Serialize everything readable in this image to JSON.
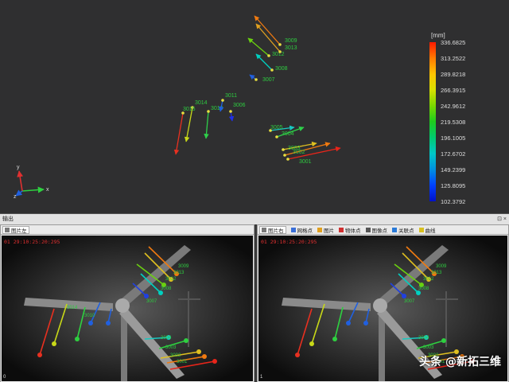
{
  "viewer3d": {
    "axes": {
      "x": "x",
      "y": "y",
      "z": "z"
    },
    "colorbar": {
      "unit": "[mm]",
      "ticks": [
        "336.6825",
        "313.2522",
        "289.8218",
        "266.3915",
        "242.9612",
        "219.5308",
        "196.1005",
        "172.6702",
        "149.2399",
        "125.8095",
        "102.3792"
      ],
      "gradient": [
        "#ff1a00",
        "#ff7a00",
        "#ffc400",
        "#d8e000",
        "#7ad800",
        "#1ecc1e",
        "#00cc70",
        "#00c8c8",
        "#0090e0",
        "#0040ff",
        "#0010c8"
      ]
    },
    "points": [
      "3001",
      "3002",
      "3003",
      "3004",
      "3005",
      "3006",
      "3007",
      "3008",
      "3009",
      "3010",
      "3011",
      "3012",
      "3013",
      "3014",
      "3015"
    ]
  },
  "output_panel": {
    "title": "输出",
    "controls": "⊡ ×",
    "left": {
      "tab": "图片左",
      "timestamp": "01 29:10:25:20:295",
      "cam_index": "0"
    },
    "right": {
      "tab": "图片右",
      "toolbar": [
        "网格点",
        "图片",
        "物体点",
        "图像点",
        "关联点",
        "曲线"
      ],
      "timestamp": "01 29:10:25:20:295",
      "cam_index": "1"
    }
  },
  "watermark": "头条 @新拓三维"
}
